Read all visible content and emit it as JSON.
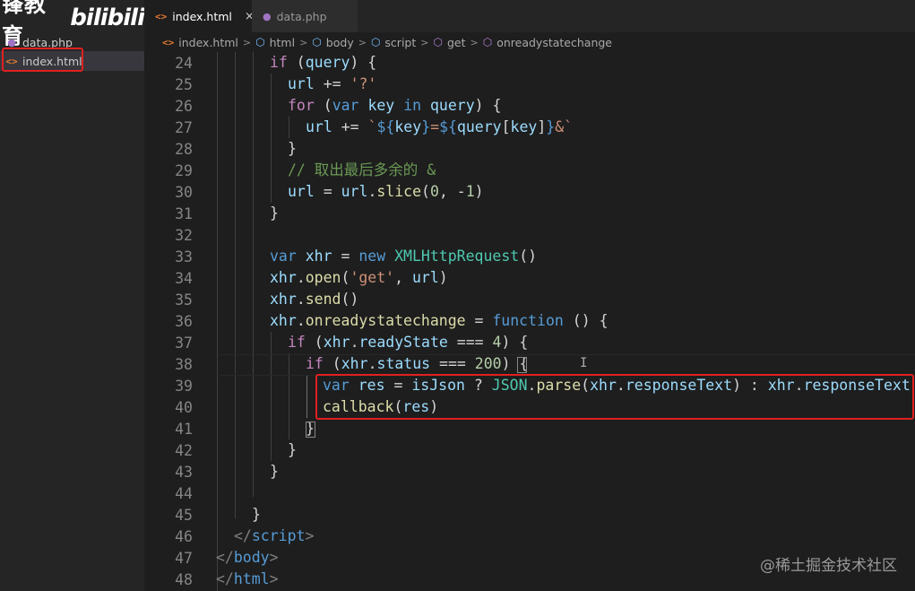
{
  "brand": {
    "name_cn": "锋教育",
    "bili_logo": "bilibili"
  },
  "sidebar": {
    "items": [
      {
        "label": "data.php",
        "icon": "php-elephant-icon"
      },
      {
        "label": "index.html",
        "icon": "html-brackets-icon"
      }
    ]
  },
  "tabs": [
    {
      "label": "index.html",
      "icon": "html-brackets-icon",
      "close": "×"
    },
    {
      "label": "data.php",
      "icon": "php-elephant-icon"
    }
  ],
  "breadcrumb": {
    "items": [
      "index.html",
      "html",
      "body",
      "script",
      "get",
      "onreadystatechange"
    ]
  },
  "editor": {
    "line_numbers": [
      "24",
      "25",
      "26",
      "27",
      "28",
      "29",
      "30",
      "31",
      "32",
      "33",
      "34",
      "35",
      "36",
      "37",
      "38",
      "39",
      "40",
      "41",
      "42",
      "43",
      "44",
      "45",
      "46",
      "47",
      "48"
    ]
  },
  "watermark": "@稀土掘金技术社区",
  "colors": {
    "highlight_box": "#e02020",
    "keyword": "#569cd6",
    "string": "#ce9178"
  }
}
